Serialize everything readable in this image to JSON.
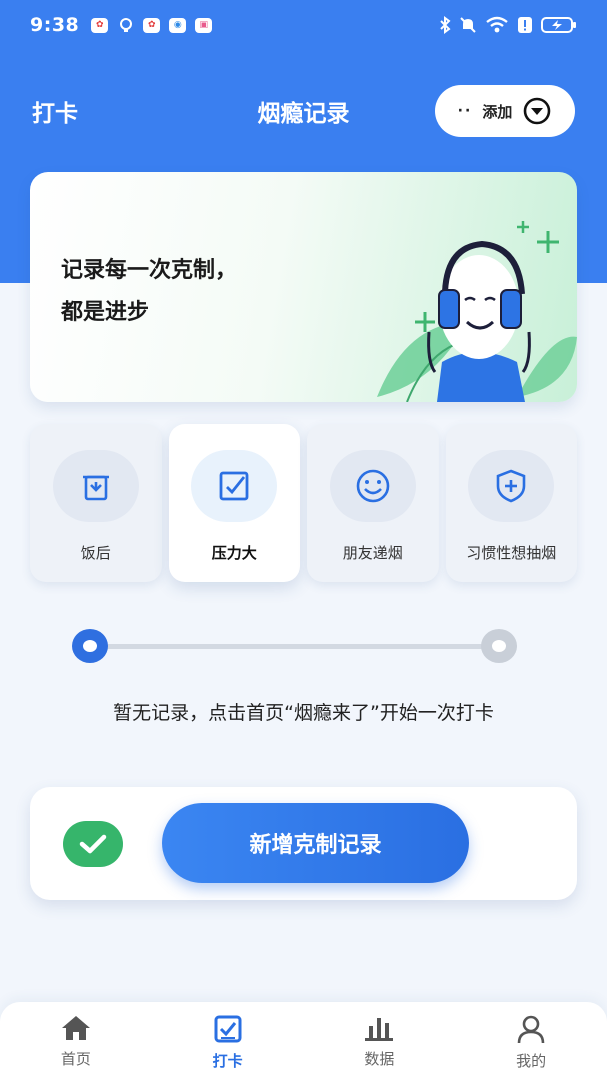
{
  "status_bar": {
    "time": "9:38",
    "apps": [
      "huawei-icon",
      "hint-icon",
      "huawei-icon",
      "browser-icon",
      "gallery-icon"
    ],
    "right_icons": [
      "bluetooth-icon",
      "mute-icon",
      "wifi-icon",
      "alert-icon",
      "battery-charging-icon"
    ]
  },
  "header": {
    "left_label": "打卡",
    "title": "烟瘾记录",
    "add_dots": "··",
    "add_label": "添加"
  },
  "banner": {
    "line1": "记录每一次克制，",
    "line2": "都是进步"
  },
  "categories": [
    {
      "label": "饭后",
      "icon": "trash-bin-icon",
      "active": false
    },
    {
      "label": "压力大",
      "icon": "check-square-icon",
      "active": true
    },
    {
      "label": "朋友递烟",
      "icon": "smile-icon",
      "active": false
    },
    {
      "label": "习惯性想抽烟",
      "icon": "shield-plus-icon",
      "active": false
    }
  ],
  "slider": {
    "value": 0
  },
  "empty_state": "暂无记录，点击首页“烟瘾来了”开始一次打卡",
  "action": {
    "button_label": "新增克制记录"
  },
  "bottom_nav": [
    {
      "label": "首页",
      "icon": "home-icon",
      "active": false
    },
    {
      "label": "打卡",
      "icon": "checkin-icon",
      "active": true
    },
    {
      "label": "数据",
      "icon": "bar-chart-icon",
      "active": false
    },
    {
      "label": "我的",
      "icon": "user-icon",
      "active": false
    }
  ],
  "colors": {
    "primary": "#3a7ff0",
    "button": "#2a6fe2",
    "success": "#36b56b",
    "banner_gradient_end": "#c8f0d8"
  }
}
